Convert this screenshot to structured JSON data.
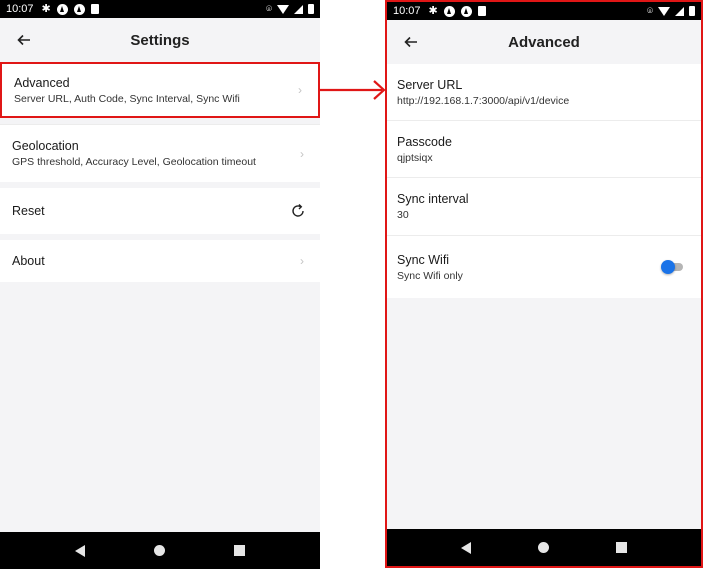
{
  "status_bar": {
    "time": "10:07"
  },
  "left_screen": {
    "title": "Settings",
    "items": [
      {
        "label": "Advanced",
        "sub": "Server URL, Auth Code, Sync Interval, Sync Wifi"
      },
      {
        "label": "Geolocation",
        "sub": "GPS threshold, Accuracy Level, Geolocation timeout"
      },
      {
        "label": "Reset"
      },
      {
        "label": "About"
      }
    ]
  },
  "right_screen": {
    "title": "Advanced",
    "items": [
      {
        "label": "Server URL",
        "value": "http://192.168.1.7:3000/api/v1/device"
      },
      {
        "label": "Passcode",
        "value": "qjptsiqx"
      },
      {
        "label": "Sync interval",
        "value": "30"
      },
      {
        "label": "Sync Wifi",
        "value": "Sync Wifi only",
        "toggle_on": true
      }
    ]
  },
  "colors": {
    "highlight": "#e01616",
    "toggle_accent": "#1a73e8",
    "background": "#f4f4f6"
  },
  "icons": [
    "gear-icon",
    "location-icon",
    "wifi-icon",
    "signal-icon",
    "battery-icon",
    "back-arrow-icon",
    "chevron-right-icon",
    "refresh-icon"
  ]
}
